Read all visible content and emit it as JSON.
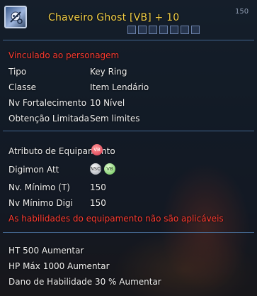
{
  "tooltip": {
    "title": "Chaveiro Ghost [VB] + 10",
    "counter": "150",
    "icon": "skull-keyring-icon"
  },
  "bind_note": "Vinculado ao personagem",
  "details": [
    {
      "label": "Tipo",
      "value": "Key Ring"
    },
    {
      "label": "Classe",
      "value": "Item Lendário"
    },
    {
      "label": "Nv Fortalecimento",
      "value": "10 Nível"
    },
    {
      "label": "Obtenção Limitada",
      "value": "Sem limites"
    }
  ],
  "attributes": {
    "equip_attr_label": "Atributo de Equipamento",
    "equip_attr_badge": "VB",
    "digimon_att_label": "Digimon Att",
    "digimon_att_badges": [
      "NSO",
      "VB"
    ],
    "min_level_tamer_label": "Nv. Mínimo (T)",
    "min_level_tamer_value": "150",
    "min_level_digi_label": "Nv Mínimo Digi",
    "min_level_digi_value": "150",
    "warning": "As habilidades do equipamento não são aplicáveis"
  },
  "bonuses": [
    "HT 500 Aumentar",
    "HP Máx 1000 Aumentar",
    "Dano de Habilidade 30 % Aumentar"
  ],
  "colors": {
    "title": "#f3cf45",
    "warning": "#ff3b30",
    "divider": "#4e78a8"
  }
}
